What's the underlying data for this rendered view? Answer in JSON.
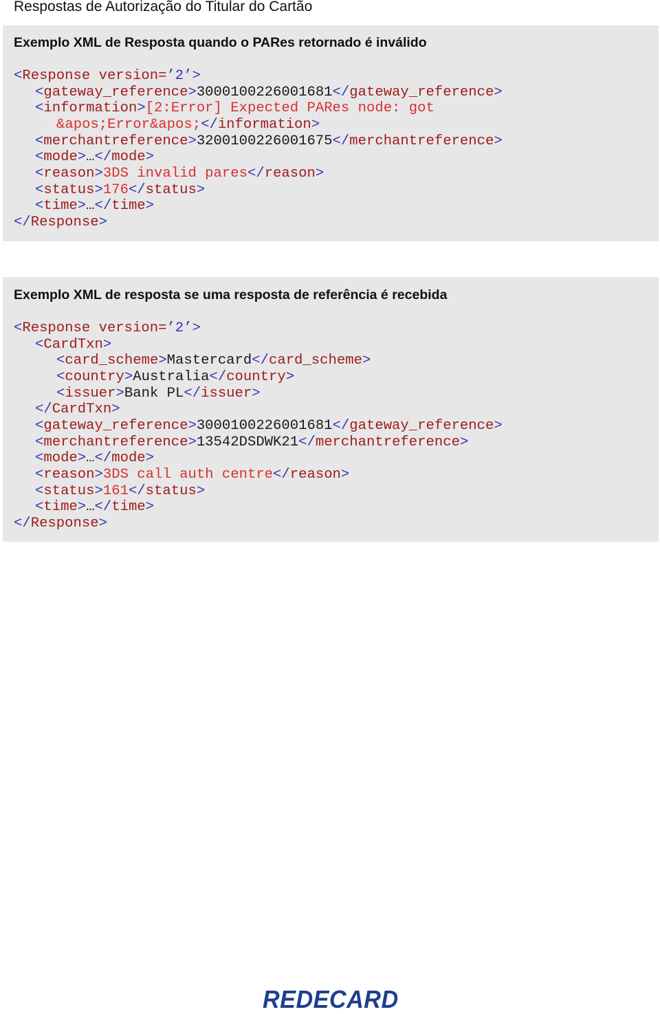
{
  "page_title": "Respostas de Autorização do Titular do Cartão",
  "blocks": [
    {
      "title": "Exemplo XML de Resposta quando o PARes retornado é inválido",
      "lines": [
        {
          "indent": 0,
          "tokens": [
            [
              "b",
              "<"
            ],
            [
              "n",
              "Response version="
            ],
            [
              "b",
              "’2’"
            ],
            [
              "b",
              ">"
            ]
          ]
        },
        {
          "indent": 1,
          "tokens": [
            [
              "b",
              "<"
            ],
            [
              "n",
              "gateway_reference"
            ],
            [
              "b",
              ">"
            ],
            [
              "k",
              "3000100226001681"
            ],
            [
              "b",
              "</"
            ],
            [
              "n",
              "gateway_reference"
            ],
            [
              "b",
              ">"
            ]
          ]
        },
        {
          "indent": 1,
          "tokens": [
            [
              "b",
              "<"
            ],
            [
              "n",
              "information"
            ],
            [
              "b",
              ">"
            ],
            [
              "v",
              "[2:Error] Expected PARes node: got"
            ]
          ]
        },
        {
          "indent": 2,
          "tokens": [
            [
              "v",
              "&apos;Error&apos;"
            ],
            [
              "b",
              "</"
            ],
            [
              "n",
              "information"
            ],
            [
              "b",
              ">"
            ]
          ]
        },
        {
          "indent": 1,
          "tokens": [
            [
              "b",
              "<"
            ],
            [
              "n",
              "merchantreference"
            ],
            [
              "b",
              ">"
            ],
            [
              "k",
              "3200100226001675"
            ],
            [
              "b",
              "</"
            ],
            [
              "n",
              "merchantreference"
            ],
            [
              "b",
              ">"
            ]
          ]
        },
        {
          "indent": 1,
          "tokens": [
            [
              "b",
              "<"
            ],
            [
              "n",
              "mode"
            ],
            [
              "b",
              ">"
            ],
            [
              "k",
              "…"
            ],
            [
              "b",
              "</"
            ],
            [
              "n",
              "mode"
            ],
            [
              "b",
              ">"
            ]
          ]
        },
        {
          "indent": 1,
          "tokens": [
            [
              "b",
              "<"
            ],
            [
              "n",
              "reason"
            ],
            [
              "b",
              ">"
            ],
            [
              "v",
              "3DS invalid pares"
            ],
            [
              "b",
              "</"
            ],
            [
              "n",
              "reason"
            ],
            [
              "b",
              ">"
            ]
          ]
        },
        {
          "indent": 1,
          "tokens": [
            [
              "b",
              "<"
            ],
            [
              "n",
              "status"
            ],
            [
              "b",
              ">"
            ],
            [
              "v",
              "176"
            ],
            [
              "b",
              "</"
            ],
            [
              "n",
              "status"
            ],
            [
              "b",
              ">"
            ]
          ]
        },
        {
          "indent": 1,
          "tokens": [
            [
              "b",
              "<"
            ],
            [
              "n",
              "time"
            ],
            [
              "b",
              ">"
            ],
            [
              "k",
              "…"
            ],
            [
              "b",
              "</"
            ],
            [
              "n",
              "time"
            ],
            [
              "b",
              ">"
            ]
          ]
        },
        {
          "indent": 0,
          "tokens": [
            [
              "b",
              "</"
            ],
            [
              "n",
              "Response"
            ],
            [
              "b",
              ">"
            ]
          ]
        }
      ]
    },
    {
      "title": "Exemplo XML de resposta se uma resposta de referência é recebida",
      "lines": [
        {
          "indent": 0,
          "tokens": [
            [
              "b",
              "<"
            ],
            [
              "n",
              "Response version="
            ],
            [
              "b",
              "’2’"
            ],
            [
              "b",
              ">"
            ]
          ]
        },
        {
          "indent": 1,
          "tokens": [
            [
              "b",
              "<"
            ],
            [
              "n",
              "CardTxn"
            ],
            [
              "b",
              ">"
            ]
          ]
        },
        {
          "indent": 2,
          "tokens": [
            [
              "b",
              "<"
            ],
            [
              "n",
              "card_scheme"
            ],
            [
              "b",
              ">"
            ],
            [
              "k",
              "Mastercard"
            ],
            [
              "b",
              "</"
            ],
            [
              "n",
              "card_scheme"
            ],
            [
              "b",
              ">"
            ]
          ]
        },
        {
          "indent": 2,
          "tokens": [
            [
              "b",
              "<"
            ],
            [
              "n",
              "country"
            ],
            [
              "b",
              ">"
            ],
            [
              "k",
              "Australia"
            ],
            [
              "b",
              "</"
            ],
            [
              "n",
              "country"
            ],
            [
              "b",
              ">"
            ]
          ]
        },
        {
          "indent": 2,
          "tokens": [
            [
              "b",
              "<"
            ],
            [
              "n",
              "issuer"
            ],
            [
              "b",
              ">"
            ],
            [
              "k",
              "Bank PL"
            ],
            [
              "b",
              "</"
            ],
            [
              "n",
              "issuer"
            ],
            [
              "b",
              ">"
            ]
          ]
        },
        {
          "indent": 1,
          "tokens": [
            [
              "b",
              "</"
            ],
            [
              "n",
              "CardTxn"
            ],
            [
              "b",
              ">"
            ]
          ]
        },
        {
          "indent": 1,
          "tokens": [
            [
              "b",
              "<"
            ],
            [
              "n",
              "gateway_reference"
            ],
            [
              "b",
              ">"
            ],
            [
              "k",
              "3000100226001681"
            ],
            [
              "b",
              "</"
            ],
            [
              "n",
              "gateway_reference"
            ],
            [
              "b",
              ">"
            ]
          ]
        },
        {
          "indent": 1,
          "tokens": [
            [
              "b",
              "<"
            ],
            [
              "n",
              "merchantreference"
            ],
            [
              "b",
              ">"
            ],
            [
              "k",
              "13542DSDWK21"
            ],
            [
              "b",
              "</"
            ],
            [
              "n",
              "merchantreference"
            ],
            [
              "b",
              ">"
            ]
          ]
        },
        {
          "indent": 1,
          "tokens": [
            [
              "b",
              "<"
            ],
            [
              "n",
              "mode"
            ],
            [
              "b",
              ">"
            ],
            [
              "k",
              "…"
            ],
            [
              "b",
              "</"
            ],
            [
              "n",
              "mode"
            ],
            [
              "b",
              ">"
            ]
          ]
        },
        {
          "indent": 1,
          "tokens": [
            [
              "b",
              "<"
            ],
            [
              "n",
              "reason"
            ],
            [
              "b",
              ">"
            ],
            [
              "v",
              "3DS call auth centre"
            ],
            [
              "b",
              "</"
            ],
            [
              "n",
              "reason"
            ],
            [
              "b",
              ">"
            ]
          ]
        },
        {
          "indent": 1,
          "tokens": [
            [
              "b",
              "<"
            ],
            [
              "n",
              "status"
            ],
            [
              "b",
              ">"
            ],
            [
              "v",
              "161"
            ],
            [
              "b",
              "</"
            ],
            [
              "n",
              "status"
            ],
            [
              "b",
              ">"
            ]
          ]
        },
        {
          "indent": 1,
          "tokens": [
            [
              "b",
              "<"
            ],
            [
              "n",
              "time"
            ],
            [
              "b",
              ">"
            ],
            [
              "k",
              "…"
            ],
            [
              "b",
              "</"
            ],
            [
              "n",
              "time"
            ],
            [
              "b",
              ">"
            ]
          ]
        },
        {
          "indent": 0,
          "tokens": [
            [
              "b",
              "</"
            ],
            [
              "n",
              "Response"
            ],
            [
              "b",
              ">"
            ]
          ]
        }
      ]
    }
  ],
  "footer": {
    "logo_text": "REDECARD"
  },
  "colors": {
    "bracket": "#3434b0",
    "tag_name": "#a01c1c",
    "value": "#d83030",
    "block_background": "#e7e7e7",
    "logo": "#1d3f8f"
  }
}
